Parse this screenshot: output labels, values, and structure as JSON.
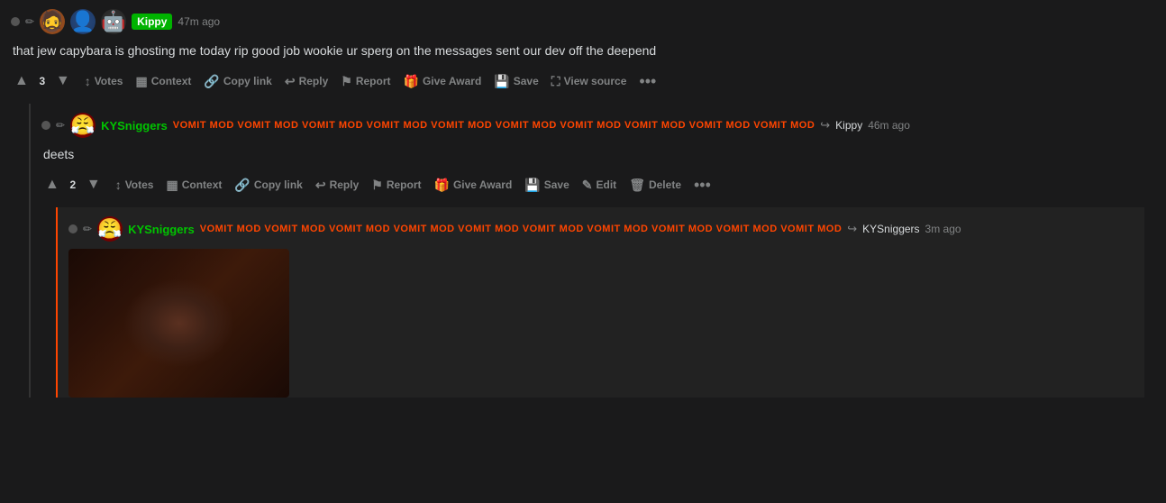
{
  "comments": [
    {
      "id": "comment-1",
      "avatars": [
        {
          "id": "av1",
          "class": "av1",
          "glyph": "🧔"
        },
        {
          "id": "av2",
          "class": "av2",
          "glyph": "👤"
        },
        {
          "id": "av3",
          "class": "av3",
          "glyph": "🤖"
        }
      ],
      "username": "Kippy",
      "username_tag": true,
      "timestamp": "47m ago",
      "body": "that jew capybara is ghosting me today rip good job wookie ur sperg on the messages sent our dev off the deepend",
      "vote_count": "3",
      "actions": [
        "Votes",
        "Context",
        "Copy link",
        "Reply",
        "Report",
        "Give Award",
        "Save",
        "View source",
        "..."
      ],
      "nested": {
        "id": "comment-2",
        "username": "KYSniggers",
        "mod_flair": "VOMIT MOD VOMIT MOD VOMIT MOD VOMIT MOD VOMIT MOD VOMIT MOD VOMIT MOD VOMIT MOD VOMIT MOD VOMIT MOD",
        "reply_to": "Kippy",
        "timestamp": "46m ago",
        "body": "deets",
        "vote_count": "2",
        "actions": [
          "Votes",
          "Context",
          "Copy link",
          "Reply",
          "Report",
          "Give Award",
          "Save",
          "Edit",
          "Delete",
          "..."
        ],
        "deep_nested": {
          "id": "comment-3",
          "username": "KYSniggers",
          "mod_flair": "VOMIT MOD VOMIT MOD VOMIT MOD VOMIT MOD VOMIT MOD VOMIT MOD VOMIT MOD VOMIT MOD VOMIT MOD VOMIT MOD",
          "reply_to": "KYSniggers",
          "timestamp": "3m ago",
          "has_image": true
        }
      }
    }
  ],
  "labels": {
    "votes": "Votes",
    "context": "Context",
    "copy_link": "Copy link",
    "reply": "Reply",
    "report": "Report",
    "give_award": "Give Award",
    "save": "Save",
    "view_source": "View source",
    "edit": "Edit",
    "delete": "Delete",
    "more": "•••"
  }
}
